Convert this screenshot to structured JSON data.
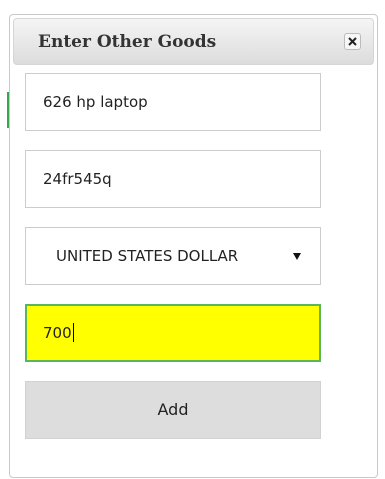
{
  "dialog": {
    "title": "Enter Other Goods",
    "close_icon": "close-icon"
  },
  "form": {
    "description_value": "626 hp laptop",
    "serial_value": "24fr545q",
    "currency_selected": "UNITED STATES DOLLAR",
    "amount_value": "700",
    "add_label": "Add"
  },
  "colors": {
    "active_field_bg": "#ffff00",
    "active_field_border": "#59b65a",
    "button_bg": "#dddddd"
  }
}
